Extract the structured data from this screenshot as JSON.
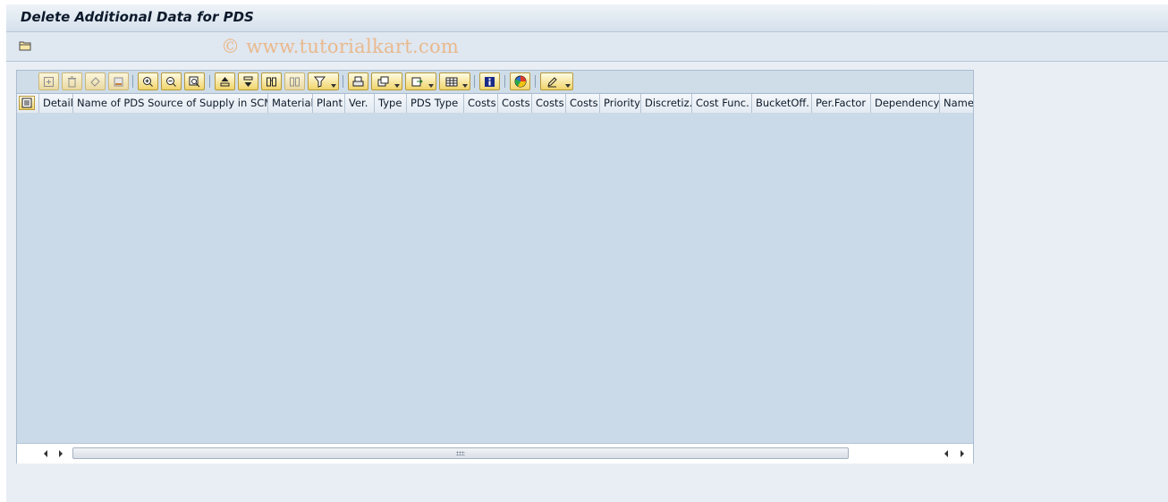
{
  "window": {
    "title": "Delete Additional Data for PDS"
  },
  "appbar": {
    "watermark": "© www.tutorialkart.com",
    "buttons": [
      {
        "icon": "open-folder-icon"
      }
    ]
  },
  "toolbar": {
    "buttons": [
      {
        "icon": "append-row-icon",
        "enabled": false
      },
      {
        "icon": "delete-row-icon",
        "enabled": false
      },
      {
        "icon": "undo-icon",
        "enabled": false
      },
      {
        "icon": "export-icon",
        "enabled": false
      },
      {
        "icon": "zoom-in-icon",
        "enabled": true
      },
      {
        "icon": "zoom-out-icon",
        "enabled": true
      },
      {
        "icon": "find-icon",
        "enabled": true
      },
      {
        "icon": "sort-ascending-icon",
        "enabled": true
      },
      {
        "icon": "sort-descending-icon",
        "enabled": true
      },
      {
        "icon": "binoculars-icon",
        "enabled": true
      },
      {
        "icon": "find-next-icon",
        "enabled": false
      },
      {
        "icon": "filter-icon",
        "enabled": true
      },
      {
        "icon": "print-icon",
        "enabled": true
      },
      {
        "icon": "views-icon",
        "enabled": true
      },
      {
        "icon": "export-dropdown-icon",
        "enabled": true
      },
      {
        "icon": "layout-icon",
        "enabled": true
      },
      {
        "icon": "info-icon",
        "enabled": true
      },
      {
        "icon": "graphic-icon",
        "enabled": true
      },
      {
        "icon": "edit-icon",
        "enabled": true
      }
    ]
  },
  "table": {
    "columns": [
      "Detail",
      "Name of PDS Source of Supply in SCM",
      "Material",
      "Plant",
      "Ver.",
      "Type",
      "PDS Type",
      "Costs",
      "Costs",
      "Costs",
      "Costs",
      "Priority",
      "Discretiz.",
      "Cost Func.",
      "BucketOff.",
      "Per.Factor",
      "Dependency",
      "Name"
    ],
    "rows": []
  },
  "colors": {
    "title_bar": "#d5e0ec",
    "grid_background": "#cbdae8",
    "toolbar_button": "#f0d46a",
    "watermark": "#e9b98d"
  }
}
